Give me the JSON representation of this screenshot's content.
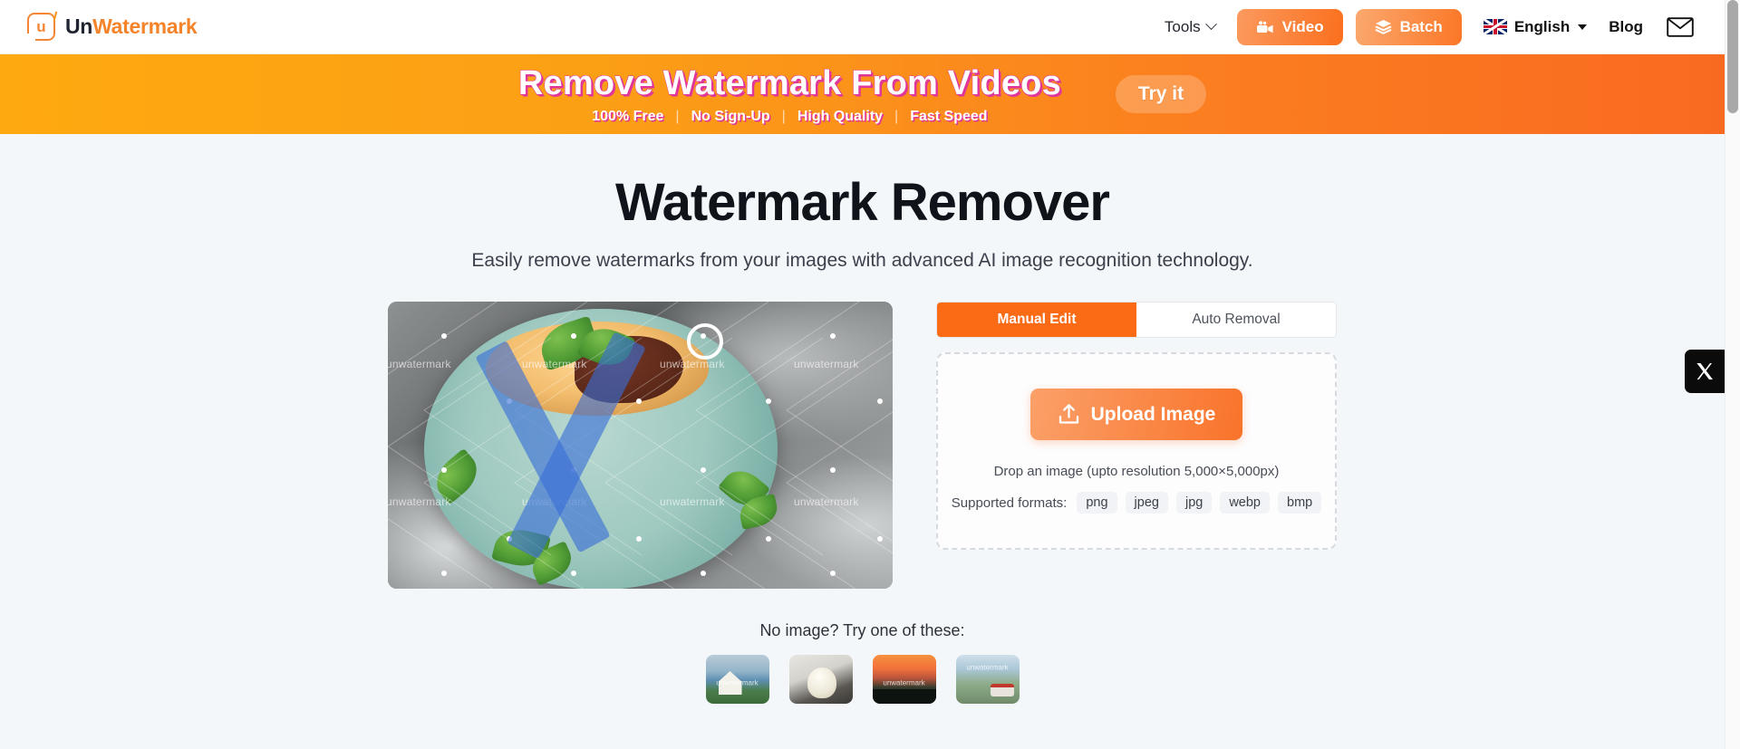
{
  "header": {
    "brand_prefix": "Un",
    "brand_suffix": "Watermark",
    "brand_mark": "u",
    "nav": {
      "tools_label": "Tools",
      "video_label": "Video",
      "batch_label": "Batch",
      "language_label": "English",
      "blog_label": "Blog"
    }
  },
  "banner": {
    "title": "Remove Watermark From Videos",
    "features": [
      "100% Free",
      "No Sign-Up",
      "High Quality",
      "Fast Speed"
    ],
    "separator": "|",
    "cta_label": "Try it"
  },
  "hero": {
    "title": "Watermark Remover",
    "subtitle": "Easily remove watermarks from your images with advanced AI image recognition technology."
  },
  "preview": {
    "watermark_text": "unwatermark",
    "alt": "Stack of pancakes with mint leaves and syrup on a teal plate"
  },
  "panel": {
    "tabs": [
      {
        "label": "Manual Edit",
        "active": true
      },
      {
        "label": "Auto Removal",
        "active": false
      }
    ],
    "upload_label": "Upload Image",
    "drop_text": "Drop an image (upto resolution 5,000×5,000px)",
    "formats_label": "Supported formats:",
    "formats": [
      "png",
      "jpeg",
      "jpg",
      "webp",
      "bmp"
    ]
  },
  "samples": {
    "label": "No image? Try one of these:",
    "items": [
      {
        "name": "house-coast",
        "watermark": "unwatermark"
      },
      {
        "name": "cat",
        "watermark": ""
      },
      {
        "name": "sunset",
        "watermark": "unwatermark"
      },
      {
        "name": "bus-road",
        "watermark": "unwatermark"
      }
    ]
  },
  "social": {
    "x_label": "X"
  },
  "colors": {
    "brand_orange": "#f5832a",
    "tab_active": "#fb6b15",
    "banner_start": "#ffa910",
    "banner_end": "#f96a21",
    "banner_shadow_pink": "#e0369a",
    "page_bg": "#f4f7fa",
    "brush_blue": "#386ed6"
  }
}
